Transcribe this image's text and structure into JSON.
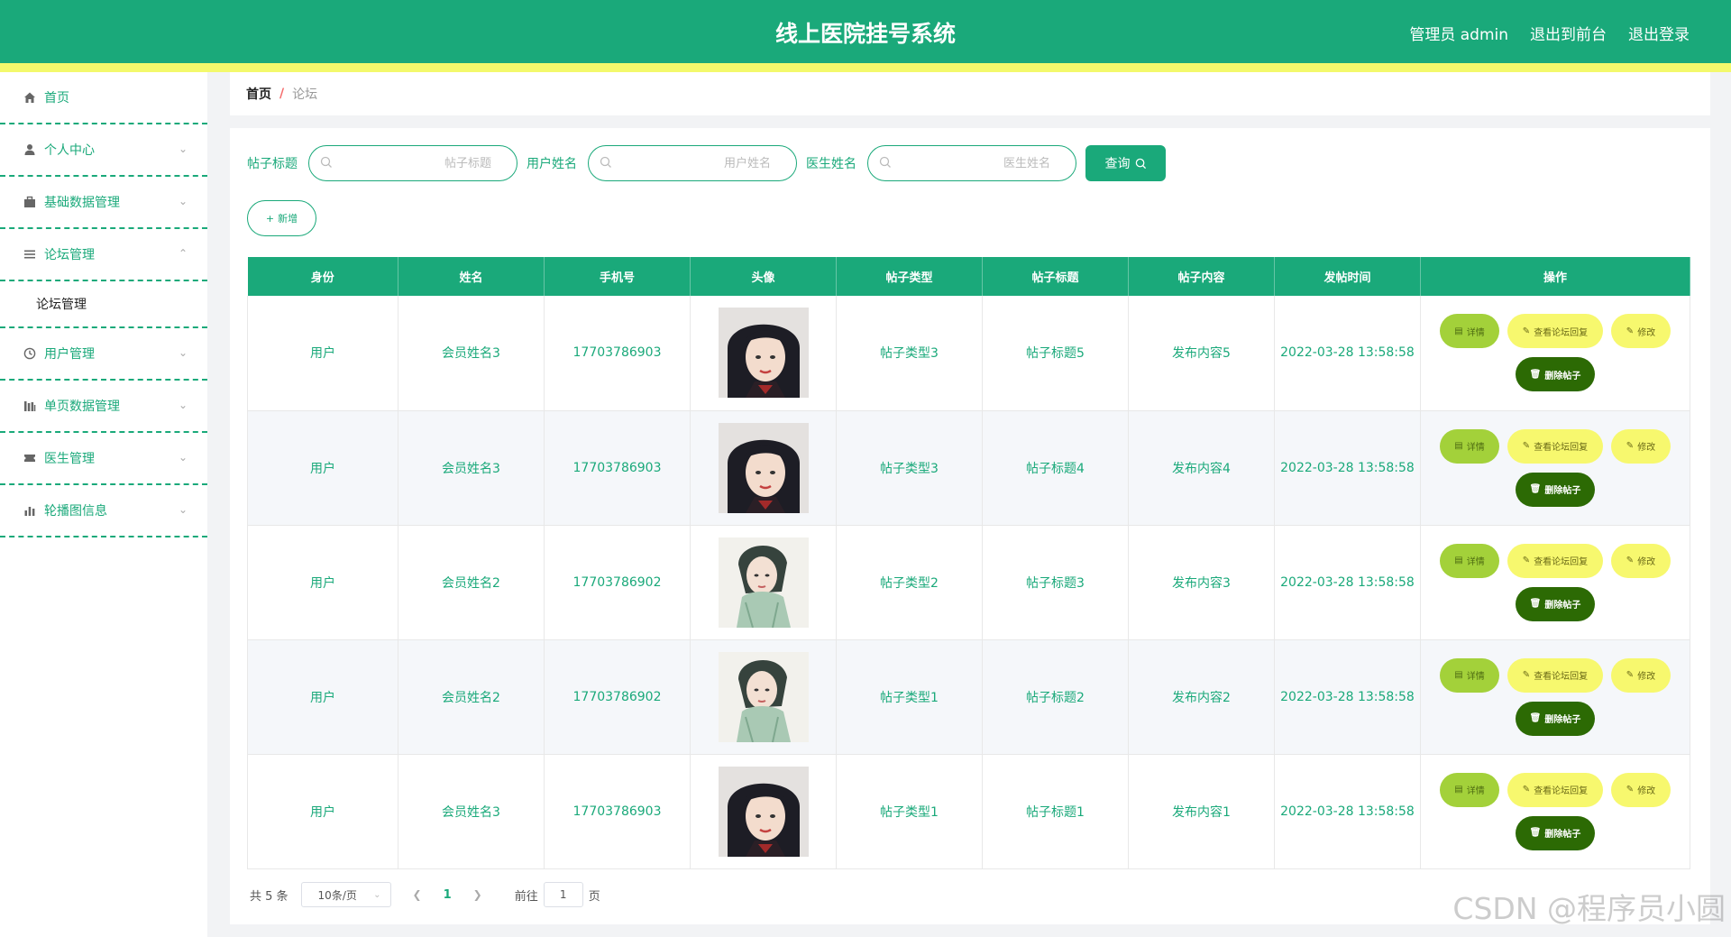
{
  "header": {
    "title": "线上医院挂号系统",
    "admin_label": "管理员 admin",
    "to_front": "退出到前台",
    "logout": "退出登录"
  },
  "sidebar": {
    "items": [
      {
        "label": "首页",
        "icon": "home-icon"
      },
      {
        "label": "个人中心",
        "icon": "user-icon"
      },
      {
        "label": "基础数据管理",
        "icon": "briefcase-icon"
      },
      {
        "label": "论坛管理",
        "icon": "list-icon"
      },
      {
        "label": "用户管理",
        "icon": "clock-icon"
      },
      {
        "label": "单页数据管理",
        "icon": "bar-icon"
      },
      {
        "label": "医生管理",
        "icon": "ticket-icon"
      },
      {
        "label": "轮播图信息",
        "icon": "chart-icon"
      }
    ],
    "sub_item": "论坛管理"
  },
  "breadcrumb": {
    "home": "首页",
    "separator": "/",
    "current": "论坛"
  },
  "filters": {
    "title_label": "帖子标题",
    "title_placeholder": "帖子标题",
    "user_label": "用户姓名",
    "user_placeholder": "用户姓名",
    "doctor_label": "医生姓名",
    "doctor_placeholder": "医生姓名",
    "query_label": "查询"
  },
  "add_label": "新增",
  "table": {
    "headers": [
      "身份",
      "姓名",
      "手机号",
      "头像",
      "帖子类型",
      "帖子标题",
      "帖子内容",
      "发帖时间",
      "操作"
    ],
    "rows": [
      {
        "role": "用户",
        "name": "会员姓名3",
        "phone": "17703786903",
        "avatar": "avatar-dark-hair",
        "type": "帖子类型3",
        "title": "帖子标题5",
        "content": "发布内容5",
        "time": "2022-03-28 13:58:58"
      },
      {
        "role": "用户",
        "name": "会员姓名3",
        "phone": "17703786903",
        "avatar": "avatar-dark-hair",
        "type": "帖子类型3",
        "title": "帖子标题4",
        "content": "发布内容4",
        "time": "2022-03-28 13:58:58"
      },
      {
        "role": "用户",
        "name": "会员姓名2",
        "phone": "17703786902",
        "avatar": "avatar-green-robe",
        "type": "帖子类型2",
        "title": "帖子标题3",
        "content": "发布内容3",
        "time": "2022-03-28 13:58:58"
      },
      {
        "role": "用户",
        "name": "会员姓名2",
        "phone": "17703786902",
        "avatar": "avatar-green-robe",
        "type": "帖子类型1",
        "title": "帖子标题2",
        "content": "发布内容2",
        "time": "2022-03-28 13:58:58"
      },
      {
        "role": "用户",
        "name": "会员姓名3",
        "phone": "17703786903",
        "avatar": "avatar-dark-hair",
        "type": "帖子类型1",
        "title": "帖子标题1",
        "content": "发布内容1",
        "time": "2022-03-28 13:58:58"
      }
    ],
    "actions": {
      "detail": "详情",
      "reply": "查看论坛回复",
      "edit": "修改",
      "delete": "删除帖子"
    }
  },
  "pagination": {
    "total": "共 5 条",
    "page_size": "10条/页",
    "current_page": "1",
    "goto_label": "前往",
    "goto_value": "1",
    "page_suffix": "页"
  },
  "watermark": "CSDN @程序员小圆",
  "colors": {
    "primary": "#1aa97a",
    "stripe": "#f3f96c",
    "detail": "#a3d13a",
    "reply": "#f7f86e",
    "delete": "#2c6a04"
  }
}
